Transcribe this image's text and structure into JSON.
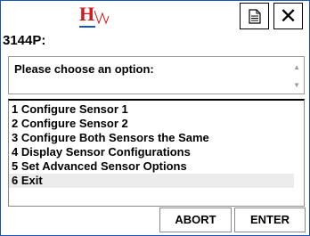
{
  "header": {
    "logo_letter": "H",
    "doc_icon": "document-icon",
    "close_label": "✕",
    "close_icon": "close-icon"
  },
  "title": "3144P:",
  "prompt": {
    "text": "Please choose an option:",
    "scroll_up": "▲",
    "scroll_down": "▼"
  },
  "options": [
    {
      "label": "1 Configure Sensor 1"
    },
    {
      "label": "2 Configure Sensor 2"
    },
    {
      "label": "3 Configure Both Sensors the Same"
    },
    {
      "label": "4 Display Sensor Configurations"
    },
    {
      "label": "5 Set Advanced Sensor Options"
    },
    {
      "label": "6 Exit"
    }
  ],
  "selected_index": 5,
  "buttons": {
    "abort": "ABORT",
    "enter": "ENTER"
  },
  "colors": {
    "brand_red": "#d01818",
    "brand_blue": "#1a56b8",
    "selection": "#ececec"
  }
}
